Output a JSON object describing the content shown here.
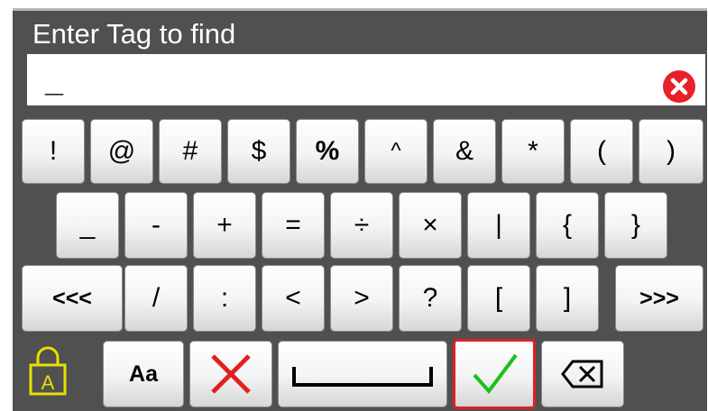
{
  "dialog": {
    "prompt": "Enter Tag to find"
  },
  "input": {
    "value": "_",
    "clear_icon": "clear-circle-icon",
    "clear_color": "#e8202a"
  },
  "keyboard": {
    "row1": [
      "!",
      "@",
      "#",
      "$",
      "%",
      "^",
      "&",
      "*",
      "(",
      ")"
    ],
    "row2": [
      "_",
      "-",
      "+",
      "=",
      "÷",
      "×",
      "|",
      "{",
      "}"
    ],
    "row3": [
      "<<<",
      "/",
      ":",
      "<",
      ">",
      "?",
      "[",
      "]",
      ">>>"
    ],
    "row4": {
      "caps_lock_icon": "caps-lock-icon",
      "case_label": "Aa",
      "cancel_icon": "cancel-x-icon",
      "space_icon": "space-bar-icon",
      "ok_icon": "check-icon",
      "backspace_icon": "backspace-icon"
    }
  },
  "colors": {
    "accent_red": "#e02020",
    "check_green": "#19c019",
    "lock_yellow": "#e8e000",
    "panel": "#505050"
  }
}
